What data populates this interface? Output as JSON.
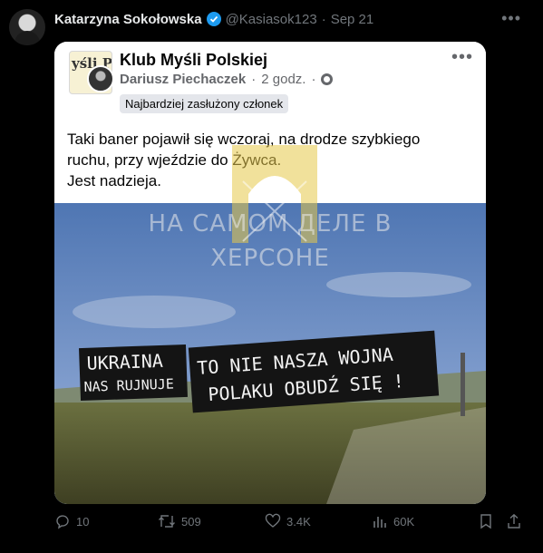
{
  "tweet": {
    "author_name": "Katarzyna Sokołowska",
    "handle": "@Kasiasok123",
    "separator": "·",
    "date": "Sep 21",
    "more_label": "•••"
  },
  "fb_post": {
    "page_logo_text": "yśli Pols",
    "group_name": "Klub Myśli Polskiej",
    "poster_name": "Dariusz Piechaczek",
    "separator": "·",
    "time": "2 godz.",
    "badge": "Najbardziej zasłużony członek",
    "more_label": "•••",
    "text_lines": [
      "Taki baner pojawił się wczoraj, na drodze szybkiego",
      "ruchu, przy wjeździe do Żywca.",
      "Jest nadzieja."
    ]
  },
  "watermark": {
    "line1": "НА САМОМ ДЕЛЕ В",
    "line2": "ХЕРСОНЕ"
  },
  "banners": {
    "left_line1": "UKRAINA",
    "left_line2": "NAS RUJNUJE",
    "right_line1": "TO NIE NASZA WOJNA",
    "right_line2": "POLAKU OBUDŹ SIĘ !"
  },
  "actions": {
    "replies": "10",
    "reposts": "509",
    "likes": "3.4K",
    "views": "60K"
  },
  "colors": {
    "background": "#000000",
    "verified": "#1d9bf0",
    "muted_text": "#71767b"
  }
}
